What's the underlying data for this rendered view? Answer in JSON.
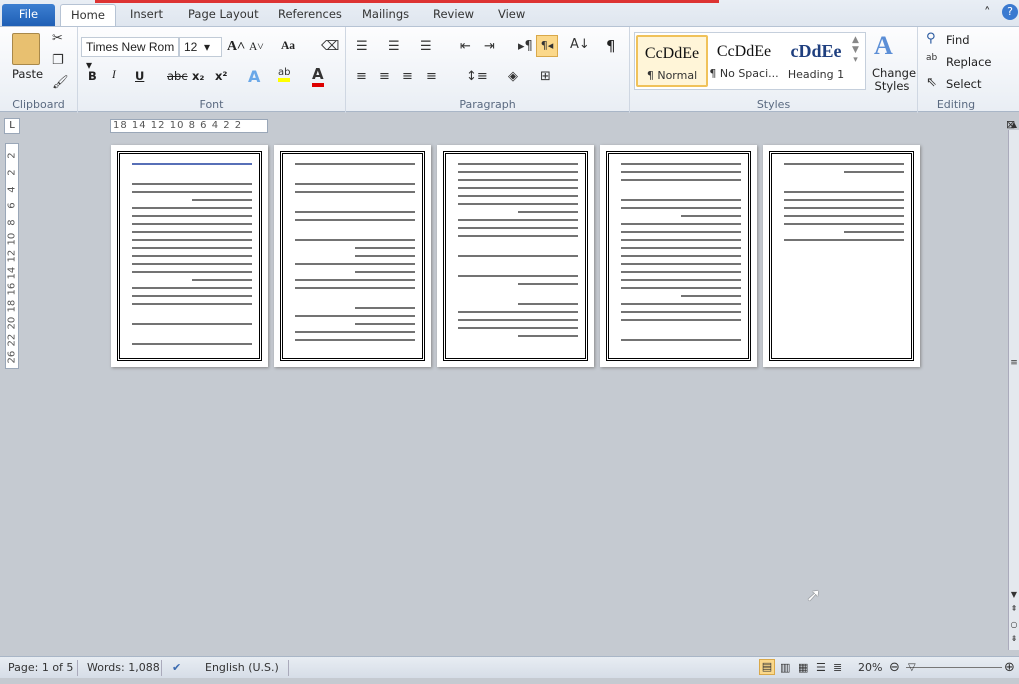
{
  "tabs": [
    "File",
    "Home",
    "Insert",
    "Page Layout",
    "References",
    "Mailings",
    "Review",
    "View"
  ],
  "clipboard": {
    "paste": "Paste",
    "label": "Clipboard"
  },
  "font": {
    "name": "Times New Rom",
    "size": "12",
    "label": "Font",
    "bold": "B",
    "italic": "I",
    "underline": "U",
    "strike": "abc",
    "sub": "x₂",
    "sup": "x²",
    "grow": "A˄",
    "shrink": "A˅",
    "case": "Aa"
  },
  "paragraph": {
    "label": "Paragraph",
    "show_marks": "¶"
  },
  "styles": {
    "label": "Styles",
    "items": [
      {
        "preview": "CcDdEe",
        "name": "¶ Normal"
      },
      {
        "preview": "CcDdEe",
        "name": "¶ No Spaci..."
      },
      {
        "preview": "cDdEe",
        "name": "Heading 1"
      }
    ],
    "change": "Change Styles"
  },
  "editing": {
    "label": "Editing",
    "find": "Find",
    "replace": "Replace",
    "select": "Select"
  },
  "ruler": {
    "h": "18  14 12 10 8  6  4  2    2",
    "v": [
      "2",
      "2",
      "4",
      "6",
      "8",
      "10",
      "12",
      "14",
      "16",
      "18",
      "20",
      "22",
      "26"
    ]
  },
  "status": {
    "page": "Page: 1 of 5",
    "words": "Words: 1,088",
    "language": "English (U.S.)",
    "zoom": "20%"
  },
  "zoom_percent": 20,
  "pages": 5,
  "colors": {
    "accent": "#1f5fb5",
    "heading_text": "#1f3f9f"
  }
}
